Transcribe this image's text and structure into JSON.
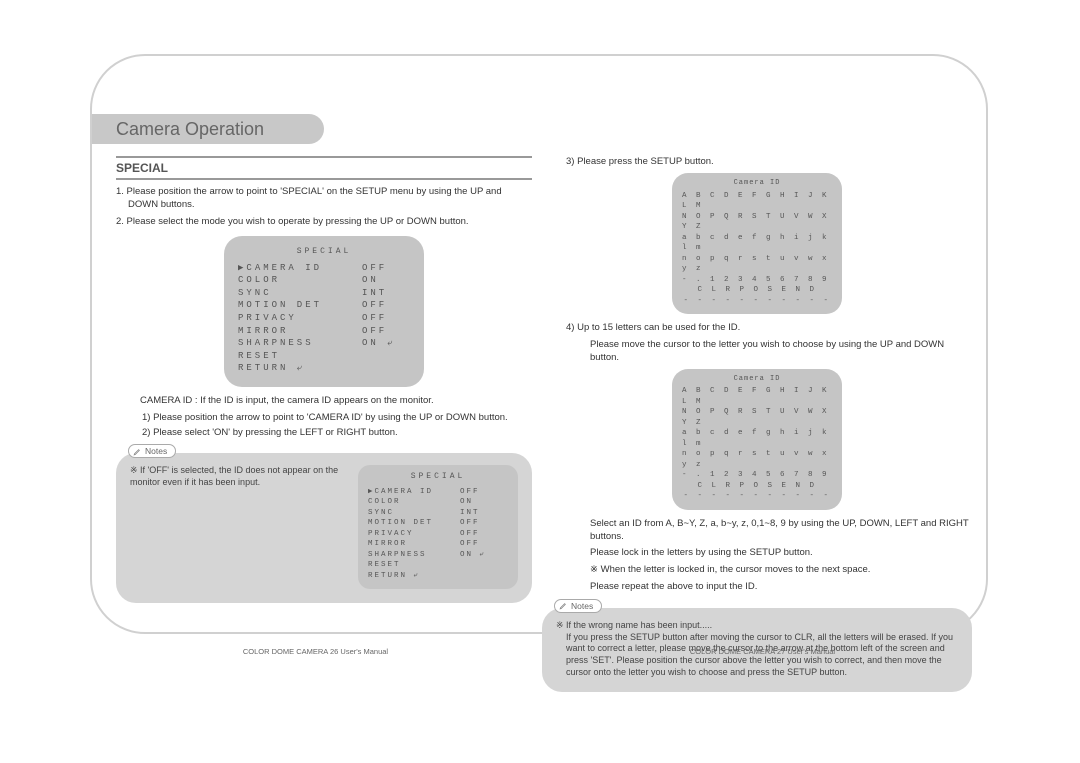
{
  "page_title": "Camera Operation",
  "heading": "SPECIAL",
  "left": {
    "step1": "1. Please position the arrow to point to 'SPECIAL' on the SETUP menu by using the UP and DOWN buttons.",
    "step2": "2. Please select the mode you wish to operate by pressing the UP or DOWN button.",
    "osd1": {
      "title": "SPECIAL",
      "rows": [
        {
          "label": "▶CAMERA ID",
          "val": "OFF"
        },
        {
          "label": " COLOR",
          "val": "ON"
        },
        {
          "label": " SYNC",
          "val": "INT"
        },
        {
          "label": " MOTION DET",
          "val": "OFF"
        },
        {
          "label": " PRIVACY",
          "val": "OFF"
        },
        {
          "label": " MIRROR",
          "val": "OFF"
        },
        {
          "label": " SHARPNESS",
          "val": "ON ⤶"
        },
        {
          "label": " RESET",
          "val": ""
        },
        {
          "label": " RETURN ⤶",
          "val": ""
        }
      ]
    },
    "camid_intro": "CAMERA ID : If the ID is input, the camera ID appears on the monitor.",
    "camid_1": "1) Please position the arrow to point to 'CAMERA ID' by using the UP or DOWN button.",
    "camid_2": "2) Please select 'ON' by pressing the LEFT or RIGHT button.",
    "notes_label": "Notes",
    "note1_text": "※ If 'OFF' is selected, the ID does not appear on the monitor even if it has been input.",
    "osd2": {
      "title": "SPECIAL",
      "rows": [
        {
          "label": "▶CAMERA ID",
          "val": "OFF"
        },
        {
          "label": " COLOR",
          "val": "ON"
        },
        {
          "label": " SYNC",
          "val": "INT"
        },
        {
          "label": " MOTION DET",
          "val": "OFF"
        },
        {
          "label": " PRIVACY",
          "val": "OFF"
        },
        {
          "label": " MIRROR",
          "val": "OFF"
        },
        {
          "label": " SHARPNESS",
          "val": "ON ⤶"
        },
        {
          "label": " RESET",
          "val": ""
        },
        {
          "label": " RETURN ⤶",
          "val": ""
        }
      ]
    }
  },
  "right": {
    "step3": "3) Please press the SETUP button.",
    "charmap_title": "Camera ID",
    "charmap_lines": [
      "A B C D E F G H I J K L M",
      "N O P Q R S T U V W X Y Z",
      "a b c d e f g h i j k l m",
      "n o p q r s t u v w x y z",
      "- .   1 2 3 4 5 6 7 8 9",
      "    C L R   P O S   E N D",
      "- - - - - - - - - - -"
    ],
    "step4a": "4) Up to 15 letters can be used for the ID.",
    "step4b": "Please move the cursor to the letter you wish to choose by using the UP and DOWN button.",
    "select_id": "Select an ID from A, B~Y, Z, a, b~y, z, 0,1~8, 9 by using the UP, DOWN, LEFT and RIGHT buttons.",
    "lock": "Please lock in the letters by using the SETUP button.",
    "locked": "※ When the letter is locked in, the cursor moves to the next space.",
    "repeat": "Please repeat the above to input the ID.",
    "notes_label": "Notes",
    "note2_a": "※ If the wrong name has been input.....",
    "note2_b": "If you press the SETUP button after moving the cursor to CLR, all the letters will be erased.   If you want to correct a letter, please move the cursor to the arrow at the bottom left of the screen and press 'SET'. Please position the cursor above the letter you wish to correct, and then move the cursor onto the letter you wish to choose and press the SETUP button."
  },
  "footer": {
    "left": "COLOR DOME CAMERA 26   User's Manual",
    "right": "COLOR DOME CAMERA 27   User's Manual"
  }
}
